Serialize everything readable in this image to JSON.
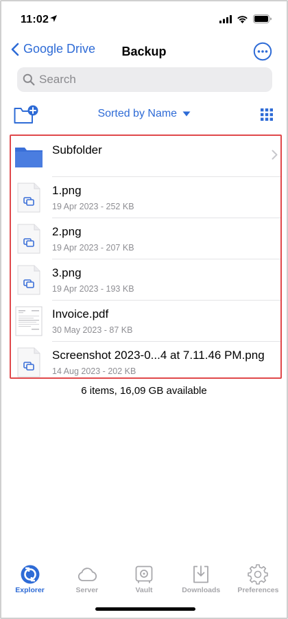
{
  "status_bar": {
    "time": "11:02"
  },
  "nav": {
    "back_label": "Google Drive",
    "title": "Backup"
  },
  "search": {
    "placeholder": "Search"
  },
  "toolbar": {
    "sort_label": "Sorted by Name"
  },
  "items": [
    {
      "name": "Subfolder",
      "meta": "",
      "kind": "folder"
    },
    {
      "name": "1.png",
      "meta": "19 Apr 2023 - 252 KB",
      "kind": "image"
    },
    {
      "name": "2.png",
      "meta": "19 Apr 2023 - 207 KB",
      "kind": "image"
    },
    {
      "name": "3.png",
      "meta": "19 Apr 2023 - 193 KB",
      "kind": "image"
    },
    {
      "name": "Invoice.pdf",
      "meta": "30 May 2023 - 87 KB",
      "kind": "pdf"
    },
    {
      "name": "Screenshot 2023-0...4 at 7.11.46 PM.png",
      "meta": "14 Aug 2023 - 202 KB",
      "kind": "image"
    }
  ],
  "summary": "6 items, 16,09 GB available",
  "tabs": [
    {
      "label": "Explorer",
      "icon": "explorer-icon",
      "active": true
    },
    {
      "label": "Server",
      "icon": "cloud-icon",
      "active": false
    },
    {
      "label": "Vault",
      "icon": "vault-icon",
      "active": false
    },
    {
      "label": "Downloads",
      "icon": "downloads-icon",
      "active": false
    },
    {
      "label": "Preferences",
      "icon": "gear-icon",
      "active": false
    }
  ],
  "colors": {
    "accent": "#2e6bd6",
    "highlight_border": "#e0474a",
    "folder": "#3a6fd8",
    "inactive": "#a7a7ab"
  }
}
